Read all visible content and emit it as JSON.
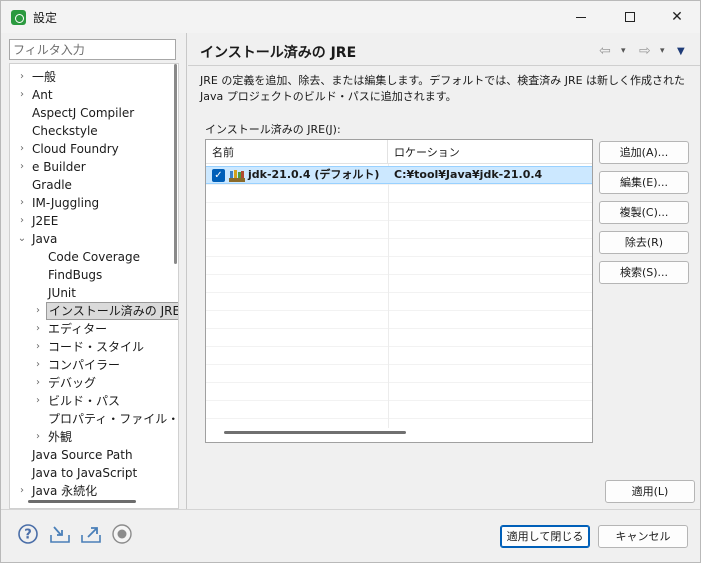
{
  "window": {
    "title": "設定"
  },
  "sidebar": {
    "filter_placeholder": "フィルタ入力",
    "items": [
      {
        "label": "一般",
        "arrow": "›"
      },
      {
        "label": "Ant",
        "arrow": "›"
      },
      {
        "label": "AspectJ Compiler",
        "arrow": ""
      },
      {
        "label": "Checkstyle",
        "arrow": ""
      },
      {
        "label": "Cloud Foundry",
        "arrow": "›"
      },
      {
        "label": "e Builder",
        "arrow": "›"
      },
      {
        "label": "Gradle",
        "arrow": ""
      },
      {
        "label": "IM-Juggling",
        "arrow": "›"
      },
      {
        "label": "J2EE",
        "arrow": "›"
      },
      {
        "label": "Java",
        "arrow": "⌄"
      },
      {
        "label": "Code Coverage",
        "arrow": ""
      },
      {
        "label": "FindBugs",
        "arrow": ""
      },
      {
        "label": "JUnit",
        "arrow": ""
      },
      {
        "label": "インストール済みの JRE",
        "arrow": "›"
      },
      {
        "label": "エディター",
        "arrow": "›"
      },
      {
        "label": "コード・スタイル",
        "arrow": "›"
      },
      {
        "label": "コンパイラー",
        "arrow": "›"
      },
      {
        "label": "デバッグ",
        "arrow": "›"
      },
      {
        "label": "ビルド・パス",
        "arrow": "›"
      },
      {
        "label": "プロパティ・ファイル・エディター",
        "arrow": ""
      },
      {
        "label": "外観",
        "arrow": "›"
      },
      {
        "label": "Java Source Path",
        "arrow": ""
      },
      {
        "label": "Java to JavaScript",
        "arrow": ""
      },
      {
        "label": "Java 永続化",
        "arrow": "›"
      }
    ]
  },
  "page": {
    "title": "インストール済みの JRE",
    "description": "JRE の定義を追加、除去、または編集します。デフォルトでは、検査済み JRE は新しく作成された Java プロジェクトのビルド・パスに追加されます。",
    "group_label": "インストール済みの JRE(J):",
    "nav_back": "⇦",
    "nav_fwd": "⇨",
    "dropdown": "▾",
    "menu": "▼"
  },
  "table": {
    "columns": [
      "名前",
      "ロケーション"
    ],
    "rows": [
      {
        "name": "jdk-21.0.4 (デフォルト)",
        "location": "C:¥tool¥Java¥jdk-21.0.4",
        "checked": true
      }
    ]
  },
  "buttons": {
    "add": "追加(A)...",
    "edit": "編集(E)...",
    "duplicate": "複製(C)...",
    "remove": "除去(R)",
    "search": "検索(S)...",
    "apply": "適用(L)",
    "apply_close": "適用して閉じる",
    "cancel": "キャンセル"
  },
  "icons": {
    "help": "help-icon",
    "import": "import-icon",
    "export": "export-icon",
    "record": "record-icon"
  },
  "colors": {
    "accent": "#005fb8",
    "selection": "#cce8ff",
    "app_icon": "#2b9a3f"
  }
}
